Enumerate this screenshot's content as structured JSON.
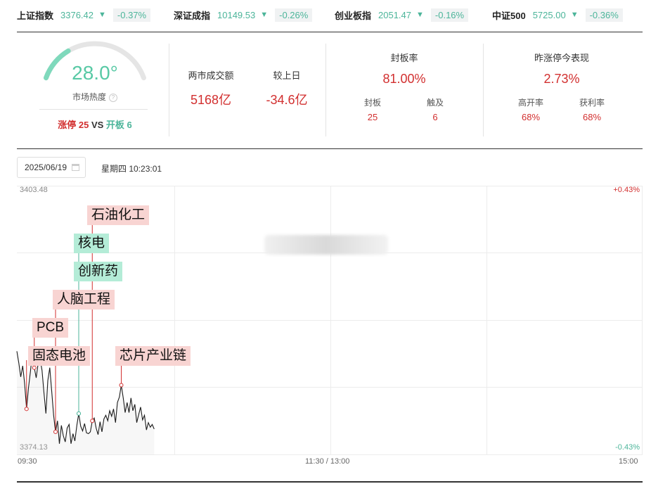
{
  "indices": [
    {
      "name": "上证指数",
      "value": "3376.42",
      "change": "-0.37%"
    },
    {
      "name": "深证成指",
      "value": "10149.53",
      "change": "-0.26%"
    },
    {
      "name": "创业板指",
      "value": "2051.47",
      "change": "-0.16%"
    },
    {
      "name": "中证500",
      "value": "5725.00",
      "change": "-0.36%"
    }
  ],
  "heat": {
    "value": "28.0°",
    "label": "市场热度",
    "level": 0.28,
    "limit_up_label": "涨停",
    "limit_up": "25",
    "vs": "VS",
    "open_label": "开板",
    "open": "6"
  },
  "turnover": {
    "label": "两市成交额",
    "value": "5168亿",
    "compare_label": "较上日",
    "compare_value": "-34.6亿"
  },
  "seal": {
    "title": "封板率",
    "rate": "81.00%",
    "sealed_label": "封板",
    "sealed": "25",
    "touched_label": "触及",
    "touched": "6"
  },
  "yesterday": {
    "title": "昨涨停今表现",
    "value": "2.73%",
    "high_open_label": "高开率",
    "high_open": "68%",
    "profit_label": "获利率",
    "profit": "68%"
  },
  "date": "2025/06/19",
  "weekday_time": "星期四 10:23:01",
  "chart_data": {
    "type": "line",
    "ylim": [
      3374.13,
      3403.48
    ],
    "y_top_label": "3403.48",
    "y_bottom_label": "3374.13",
    "right_top_label": "+0.43%",
    "right_bottom_label": "-0.43%",
    "x_labels": [
      "09:30",
      "11:30 / 13:00",
      "15:00"
    ],
    "series": [
      {
        "values": [
          3385.4,
          3384.1,
          3382.6,
          3383.8,
          3381.9,
          3379.1,
          3381.4,
          3383.2,
          3385.2,
          3383.6,
          3382.5,
          3384.1,
          3384.6,
          3383.3,
          3380.9,
          3378.6,
          3382.2,
          3383.6,
          3381.1,
          3378.4,
          3376.6,
          3377.8,
          3375.3,
          3377.3,
          3376.2,
          3375.5,
          3377.0,
          3377.4,
          3375.3,
          3376.4,
          3375.6,
          3377.3,
          3378.6,
          3377.2,
          3376.7,
          3377.5,
          3376.5,
          3376.4,
          3376.6,
          3377.8,
          3378.1,
          3377.0,
          3376.3,
          3377.7,
          3376.6,
          3378.0,
          3378.4,
          3377.8,
          3378.9,
          3378.3,
          3379.1,
          3377.6,
          3379.8,
          3380.4,
          3381.7,
          3380.3,
          3378.7,
          3379.8,
          3378.7,
          3380.3,
          3378.9,
          3379.6,
          3377.6,
          3378.5,
          3379.3,
          3377.9,
          3378.4,
          3376.8,
          3377.6,
          3377.1,
          3377.4,
          3376.9
        ]
      }
    ],
    "events": [
      {
        "label": "固态电池",
        "kind": "up",
        "index": 5
      },
      {
        "label": "PCB",
        "kind": "up",
        "index": 9
      },
      {
        "label": "人脑工程",
        "kind": "up",
        "index": 20
      },
      {
        "label": "创新药",
        "kind": "dn",
        "index": 32
      },
      {
        "label": "核电",
        "kind": "dn",
        "index": 32
      },
      {
        "label": "石油化工",
        "kind": "up",
        "index": 39
      },
      {
        "label": "芯片产业链",
        "kind": "up",
        "index": 54
      }
    ]
  }
}
